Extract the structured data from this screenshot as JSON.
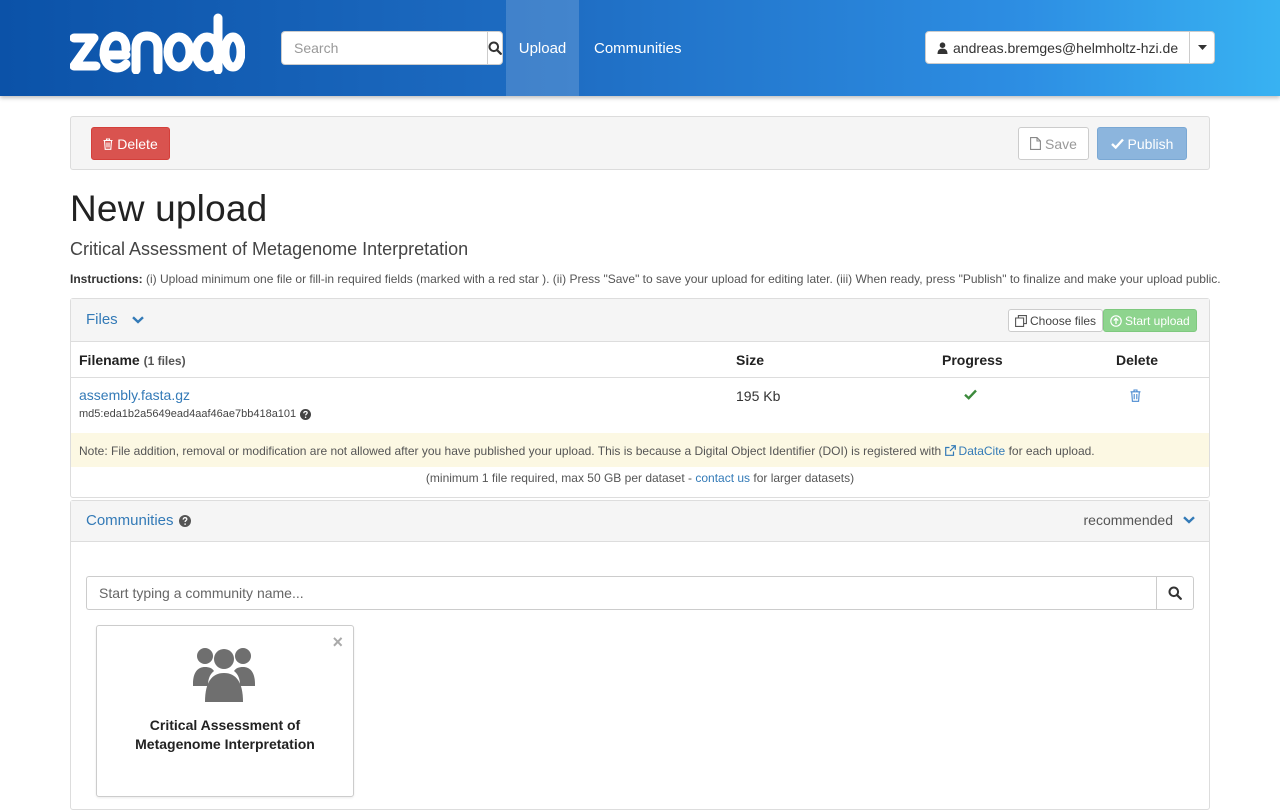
{
  "header": {
    "logo_text": "zenodo",
    "search_placeholder": "Search",
    "nav": [
      {
        "label": "Upload"
      },
      {
        "label": "Communities"
      }
    ],
    "user_email": "andreas.bremges@helmholtz-hzi.de"
  },
  "toolbar": {
    "delete_label": "Delete",
    "save_label": "Save",
    "publish_label": "Publish"
  },
  "page": {
    "title": "New upload",
    "subtitle": "Critical Assessment of Metagenome Interpretation",
    "instructions_label": "Instructions:",
    "instructions_text": " (i) Upload minimum one file or fill-in required fields (marked with a red star ). (ii) Press \"Save\" to save your upload for editing later. (iii) When ready, press \"Publish\" to finalize and make your upload public."
  },
  "files": {
    "panel_title": "Files",
    "choose_label": "Choose files",
    "start_label": "Start upload",
    "columns": {
      "filename": "Filename",
      "filename_count": "(1 files)",
      "size": "Size",
      "progress": "Progress",
      "delete": "Delete"
    },
    "rows": [
      {
        "name": "assembly.fasta.gz",
        "md5": "md5:eda1b2a5649ead4aaf46ae7bb418a101",
        "size": "195 Kb",
        "progress": "complete"
      }
    ],
    "note_before": "Note: File addition, removal or modification are not allowed after you have published your upload. This is because a Digital Object Identifier (DOI) is registered with ",
    "note_link": "DataCite",
    "note_after": " for each upload.",
    "limit_before": "(minimum 1 file required, max 50 GB per dataset - ",
    "limit_link": "contact us",
    "limit_after": " for larger datasets)"
  },
  "communities": {
    "panel_title": "Communities",
    "recommended_label": "recommended",
    "search_placeholder": "Start typing a community name...",
    "cards": [
      {
        "name": "Critical Assessment of Metagenome Interpretation"
      }
    ]
  },
  "colors": {
    "brand_dark": "#0b52a8",
    "brand_light": "#38b2f2",
    "link": "#337ab7",
    "danger": "#d9534f",
    "success": "#3c8a3c",
    "publish": "#8cb5dd"
  }
}
